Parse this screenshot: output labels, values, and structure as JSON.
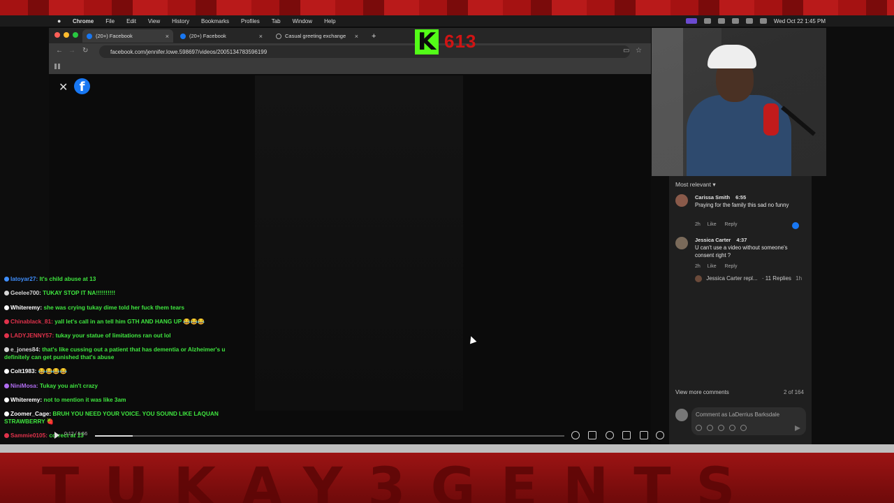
{
  "menubar": {
    "app": "Chrome",
    "items": [
      "File",
      "Edit",
      "View",
      "History",
      "Bookmarks",
      "Profiles",
      "Tab",
      "Window",
      "Help"
    ],
    "datetime": "Wed Oct 22  1:45 PM"
  },
  "tabs": [
    {
      "label": "(20+) Facebook",
      "active": true
    },
    {
      "label": "(20+) Facebook",
      "active": false
    },
    {
      "label": "Casual greeting exchange",
      "active": false
    }
  ],
  "address_bar": {
    "url": "facebook.com/jennifer.lowe.598697/videos/2005134783596199"
  },
  "kick": {
    "logo": "K",
    "viewer_count": "613"
  },
  "player": {
    "time": "0:12 / 5:56",
    "progress": 0.08
  },
  "comments": {
    "sort_label": "Most relevant",
    "items": [
      {
        "name": "Carissa Smith",
        "duration": "6:55",
        "text": "Praying for the family this sad no funny",
        "age": "2h",
        "like": "Like",
        "reply": "Reply"
      },
      {
        "name": "Jessica Carter",
        "duration": "4:37",
        "text": "U can't use a video without someone's consent right ?",
        "age": "2h",
        "like": "Like",
        "reply": "Reply"
      }
    ],
    "replies_text": "Jessica Carter repl...",
    "replies_count": "· 11 Replies",
    "replies_age": "1h",
    "view_more": "View more comments",
    "count": "2 of 164",
    "composer_placeholder": "Comment as LaDerrius Barksdale"
  },
  "chat": [
    {
      "user": "latoyar27",
      "msg": "It's child abuse at 13",
      "user_color": "#3f8fff"
    },
    {
      "user": "Geelee700",
      "msg": "TUKAY STOP IT NA!!!!!!!!!!",
      "user_color": "#d6d6d6"
    },
    {
      "user": "Whiteremy",
      "msg": "she was crying tukay dime told her fuck them tears",
      "user_color": "#ffffff"
    },
    {
      "user": "Chinablack_81",
      "msg": "yall let's call in an tell him GTH AND HANG UP 😂😂😂",
      "user_color": "#e0324b"
    },
    {
      "user": "LADYJENNY57",
      "msg": "tukay your statue of limitations ran out lol",
      "user_color": "#e0324b"
    },
    {
      "user": "e_jones84",
      "msg": "that's like cussing out a patient that has dementia or Alzheimer's u definitely can get punished that's abuse",
      "user_color": "#d6d6d6"
    },
    {
      "user": "Colt1983",
      "msg": "😂😂😂😂",
      "user_color": "#ffffff"
    },
    {
      "user": "NiniMosa",
      "msg": "Tukay you ain't crazy",
      "user_color": "#b06cf0"
    },
    {
      "user": "Whiteremy",
      "msg": "not to mention it was like 3am",
      "user_color": "#ffffff"
    },
    {
      "user": "Zoomer_Cage",
      "msg": "BRUH YOU NEED YOUR VOICE. YOU SOUND LIKE LAQUAN STRAWBERRY 🍓",
      "user_color": "#ffffff"
    },
    {
      "user": "Sammie0105",
      "msg": "correct at 13",
      "user_color": "#e0324b"
    }
  ],
  "banner": {
    "text": "TUKAY3GENTS"
  },
  "colors": {
    "kick_green": "#53fc18",
    "facebook_blue": "#1877f2",
    "chat_msg": "#3fe63f",
    "banner_red": "#8a1010"
  }
}
